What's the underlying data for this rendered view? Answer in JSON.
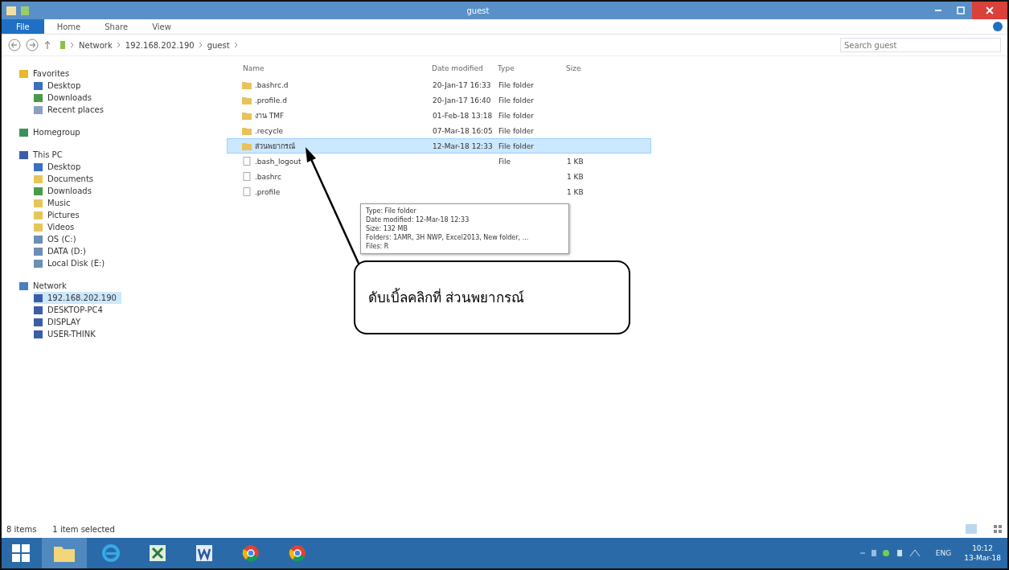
{
  "window": {
    "title": "guest"
  },
  "ribbon_tabs": [
    {
      "label": "File",
      "kind": "file"
    },
    {
      "label": "Home",
      "kind": "tab"
    },
    {
      "label": "Share",
      "kind": "tab"
    },
    {
      "label": "View",
      "kind": "tab"
    }
  ],
  "address": {
    "path": [
      "Network",
      "192.168.202.190",
      "guest"
    ]
  },
  "search": {
    "placeholder": "Search guest"
  },
  "sidebar": [
    {
      "label": "Favorites",
      "children": [
        {
          "label": "Desktop",
          "selected": false
        },
        {
          "label": "Downloads",
          "selected": false
        },
        {
          "label": "Recent places",
          "selected": false
        }
      ]
    },
    {
      "label": "Homegroup"
    },
    {
      "label": "This PC",
      "children": [
        {
          "label": "Desktop",
          "selected": false
        },
        {
          "label": "Documents",
          "selected": false
        },
        {
          "label": "Downloads",
          "selected": false
        },
        {
          "label": "Music",
          "selected": false
        },
        {
          "label": "Pictures",
          "selected": false
        },
        {
          "label": "Videos",
          "selected": false
        },
        {
          "label": "OS (C:)",
          "selected": false
        },
        {
          "label": "DATA (D:)",
          "selected": false
        },
        {
          "label": "Local Disk (E:)",
          "selected": false
        }
      ]
    },
    {
      "label": "Network",
      "children": [
        {
          "label": "192.168.202.190",
          "selected": true
        },
        {
          "label": "DESKTOP-PC4",
          "selected": false
        },
        {
          "label": "DISPLAY",
          "selected": false
        },
        {
          "label": "USER-THINK",
          "selected": false
        }
      ]
    }
  ],
  "table": {
    "columns": [
      "Name",
      "Date modified",
      "Type",
      "Size"
    ],
    "rows": [
      {
        "name": ".bashrc.d",
        "date": "20-Jan-17 16:33",
        "type": "File folder",
        "kind": "folder",
        "selected": false
      },
      {
        "name": ".profile.d",
        "date": "20-Jan-17 16:40",
        "type": "File folder",
        "kind": "folder",
        "selected": false
      },
      {
        "name": "งาน TMF",
        "date": "01-Feb-18 13:18",
        "type": "File folder",
        "kind": "folder",
        "selected": false
      },
      {
        "name": ".recycle",
        "date": "07-Mar-18 16:05",
        "type": "File folder",
        "kind": "folder",
        "selected": false
      },
      {
        "name": "ส่วนพยากรณ์",
        "date": "12-Mar-18 12:33",
        "type": "File folder",
        "kind": "folder",
        "selected": true
      },
      {
        "name": ".bash_logout",
        "type": "File",
        "size": "1 KB",
        "kind": "file",
        "selected": false
      },
      {
        "name": ".bashrc",
        "size": "1 KB",
        "kind": "file",
        "selected": false
      },
      {
        "name": ".profile",
        "size": "1 KB",
        "kind": "file",
        "selected": false
      }
    ]
  },
  "tooltip": {
    "lines": [
      "Type: File folder",
      "Date modified: 12-Mar-18 12:33",
      "Size: 132 MB",
      "Folders: 1AMR, 3H NWP, Excel2013, New folder, ...",
      "Files: R"
    ]
  },
  "callout": {
    "text": "ดับเบิ้ลคลิกที่ ส่วนพยากรณ์"
  },
  "status_bar": {
    "items": "8 items",
    "selection": "1 item selected"
  },
  "taskbar": {
    "apps": [
      {
        "kind": "explorer",
        "active": true
      },
      {
        "kind": "ie",
        "active": false
      },
      {
        "kind": "excel",
        "active": false
      },
      {
        "kind": "word",
        "active": false
      },
      {
        "kind": "chrome",
        "active": false
      },
      {
        "kind": "chrome",
        "active": false
      }
    ],
    "language": "ENG",
    "time": "10:12",
    "date": "13-Mar-18"
  }
}
